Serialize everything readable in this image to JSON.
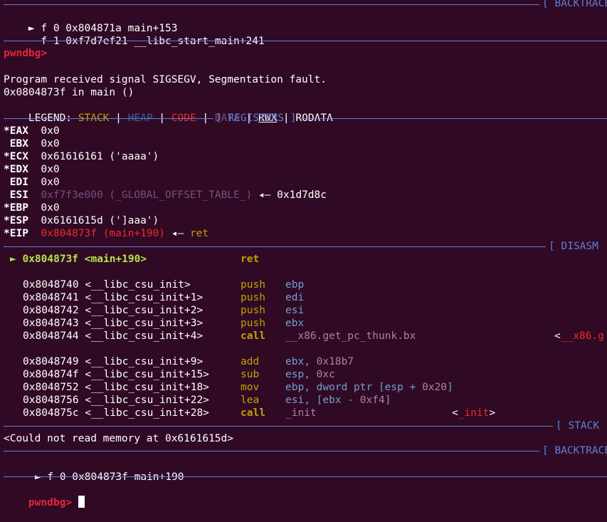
{
  "backtrace_top": {
    "label": "[ BACKTRACE",
    "frames": [
      {
        "marker": "►",
        "text": "f 0 0x804871a main+153"
      },
      {
        "marker": " ",
        "text": "f 1 0xf7d7ef21 __libc_start_main+241"
      }
    ]
  },
  "prompt1": "pwndbg>",
  "signal": {
    "line1": "Program received signal SIGSEGV, Segmentation fault.",
    "line2": "0x0804873f in main ()"
  },
  "legend": {
    "label": "LEGEND:",
    "stack": "STACK",
    "heap": "HEAP",
    "code": "CODE",
    "data": "DATA",
    "rwx": "RWX",
    "rodata": "RODATA"
  },
  "registers": {
    "label": "[ REGISTERS ]",
    "rows": [
      {
        "mark": "*",
        "name": "EAX",
        "value": "0x0"
      },
      {
        "mark": " ",
        "name": "EBX",
        "value": "0x0"
      },
      {
        "mark": "*",
        "name": "ECX",
        "value": "0x61616161 ('aaaa')"
      },
      {
        "mark": "*",
        "name": "EDX",
        "value": "0x0"
      },
      {
        "mark": " ",
        "name": "EDI",
        "value": "0x0"
      },
      {
        "mark": " ",
        "name": "ESI",
        "value": "0xf7f3e000 (_GLOBAL_OFFSET_TABLE_)",
        "arrow": "◂—",
        "deref": "0x1d7d8c"
      },
      {
        "mark": "*",
        "name": "EBP",
        "value": "0x0"
      },
      {
        "mark": "*",
        "name": "ESP",
        "value": "0x6161615d (']aaa')"
      },
      {
        "mark": "*",
        "name": "EIP",
        "value": "0x804873f (main+190)",
        "arrow": "◂—",
        "deref": "ret"
      }
    ]
  },
  "disasm": {
    "label": "[ DISASM",
    "current": {
      "marker": "►",
      "addr": "0x804873f",
      "sym": "<main+190>",
      "op": "ret"
    },
    "rows": [
      {
        "addr": "0x8048740",
        "sym": "<__libc_csu_init>",
        "op": "push",
        "arg": "ebp"
      },
      {
        "addr": "0x8048741",
        "sym": "<__libc_csu_init+1>",
        "op": "push",
        "arg": "edi"
      },
      {
        "addr": "0x8048742",
        "sym": "<__libc_csu_init+2>",
        "op": "push",
        "arg": "esi"
      },
      {
        "addr": "0x8048743",
        "sym": "<__libc_csu_init+3>",
        "op": "push",
        "arg": "ebx"
      },
      {
        "addr": "0x8048744",
        "sym": "<__libc_csu_init+4>",
        "op": "call",
        "arg": "__x86.get_pc_thunk.bx",
        "target_open": "<",
        "target": "__x86.g"
      },
      {
        "addr": "0x8048749",
        "sym": "<__libc_csu_init+9>",
        "op": "add",
        "arg": "ebx,",
        "arg2": "0x18b7"
      },
      {
        "addr": "0x804874f",
        "sym": "<__libc_csu_init+15>",
        "op": "sub",
        "arg": "esp,",
        "arg2": "0xc"
      },
      {
        "addr": "0x8048752",
        "sym": "<__libc_csu_init+18>",
        "op": "mov",
        "arg": "ebp, dword ptr [esp +",
        "arg2": "0x20",
        "arg3": "]"
      },
      {
        "addr": "0x8048756",
        "sym": "<__libc_csu_init+22>",
        "op": "lea",
        "arg": "esi, [ebx -",
        "arg2": "0xf4",
        "arg3": "]"
      },
      {
        "addr": "0x804875c",
        "sym": "<__libc_csu_init+28>",
        "op": "call",
        "arg": "_init",
        "target_open": "<",
        "target": "_init",
        "target_close": ">"
      }
    ]
  },
  "stack": {
    "label": "[ STACK",
    "message": "<Could not read memory at 0x6161615d>"
  },
  "backtrace_bottom": {
    "label": "[ BACKTRACE",
    "frames": [
      {
        "marker": "►",
        "text": "f 0 0x804873f main+190"
      }
    ]
  },
  "prompt2": "pwndbg>",
  "colors": {
    "background": "#300a24",
    "separator": "#5e7fd6",
    "prompt": "#e2263b",
    "stack": "#c4a000",
    "heap": "#3465a4",
    "code": "#ef2929",
    "data": "#75507b",
    "current_line": "#b5e24a",
    "immediate": "#ad7fa8"
  }
}
